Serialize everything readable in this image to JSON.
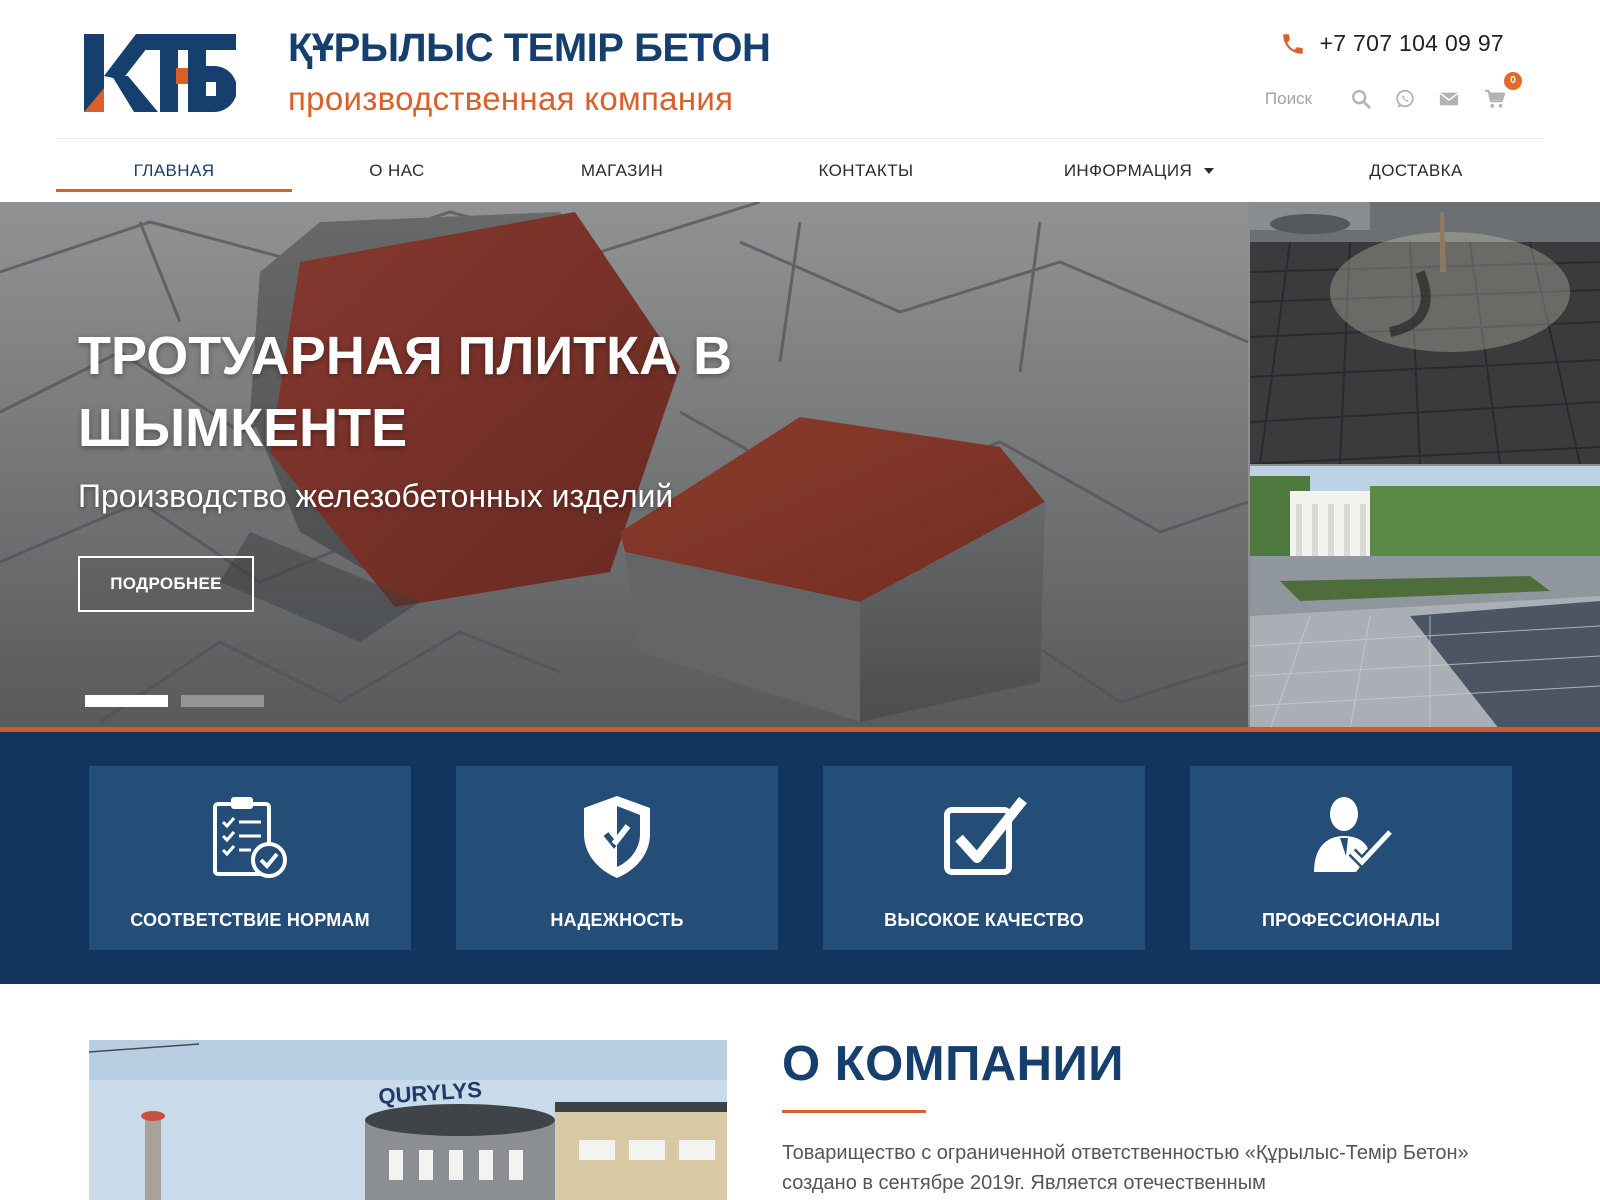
{
  "header": {
    "brand_title": "ҚҰРЫЛЫС ТЕМІР БЕТОН",
    "brand_subtitle": "производственная компания",
    "phone": "+7 707 104 09 97",
    "search_placeholder": "Поиск",
    "cart_count": "0"
  },
  "nav": {
    "items": [
      {
        "label": "ГЛАВНАЯ"
      },
      {
        "label": "О НАС"
      },
      {
        "label": "МАГАЗИН"
      },
      {
        "label": "КОНТАКТЫ"
      },
      {
        "label": "ИНФОРМАЦИЯ"
      },
      {
        "label": "ДОСТАВКА"
      }
    ],
    "active_index": 0
  },
  "hero": {
    "title": "ТРОТУАРНАЯ ПЛИТКА В ШЫМКЕНТЕ",
    "subtitle": "Производство железобетонных изделий",
    "button_label": "ПОДРОБНЕЕ",
    "slides_total": 2,
    "slide_active": 1
  },
  "features": [
    {
      "label": "СООТВЕТСТВИЕ НОРМАМ",
      "icon": "clipboard-check-icon"
    },
    {
      "label": "НАДЕЖНОСТЬ",
      "icon": "shield-icon"
    },
    {
      "label": "ВЫСОКОЕ КАЧЕСТВО",
      "icon": "checkbox-icon"
    },
    {
      "label": "ПРОФЕССИОНАЛЫ",
      "icon": "professional-icon"
    }
  ],
  "about": {
    "title": "О КОМПАНИИ",
    "text": "Товарищество с ограниченной ответственностью «Құрылыс-Темір Бетон» создано в сентябре 2019г. Является отечественным",
    "building_sign": "QURYLYS"
  },
  "colors": {
    "navy": "#163f6e",
    "accent": "#d9602a",
    "feature_bg": "#12355f",
    "feature_card": "#244d78"
  }
}
